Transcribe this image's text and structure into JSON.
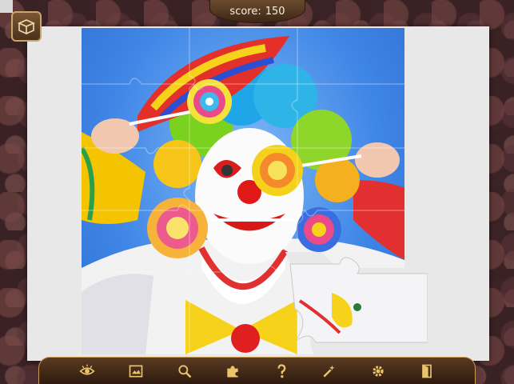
{
  "score": {
    "label": "score:",
    "value": "150"
  },
  "toolbar": {
    "items": [
      {
        "name": "show-edges",
        "icon": "eye-icon"
      },
      {
        "name": "show-picture",
        "icon": "picture-icon"
      },
      {
        "name": "zoom",
        "icon": "magnifier-icon"
      },
      {
        "name": "sort-pieces",
        "icon": "puzzle-piece-icon"
      },
      {
        "name": "hint",
        "icon": "question-icon"
      },
      {
        "name": "auto-place",
        "icon": "magic-wand-icon"
      },
      {
        "name": "settings",
        "icon": "gear-icon"
      },
      {
        "name": "exit",
        "icon": "door-icon"
      }
    ]
  },
  "colors": {
    "gold": "#e9c46a",
    "sky": "#3f86e6",
    "board": "#e8e8e8"
  }
}
